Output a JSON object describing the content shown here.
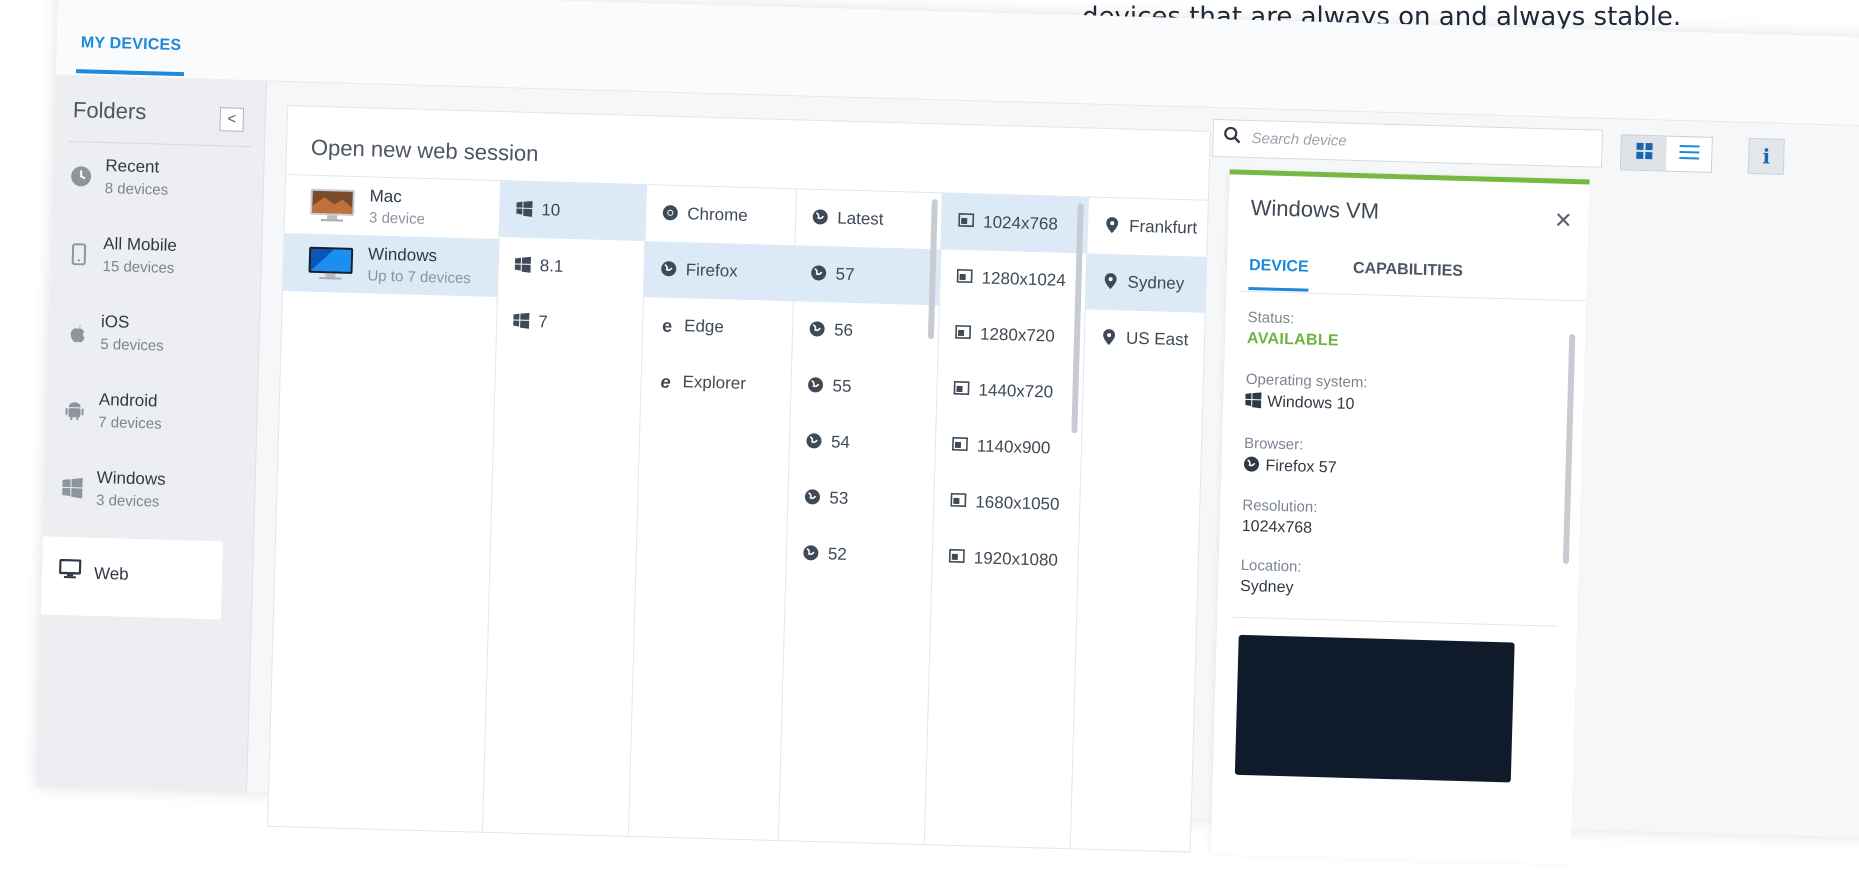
{
  "tagline": "devices that are always on and always stable.",
  "header": {
    "tab_label": "MY DEVICES"
  },
  "sidebar": {
    "title": "Folders",
    "collapse_icon": "chevron-left-icon",
    "items": [
      {
        "name": "Recent",
        "count": "8 devices",
        "icon": "clock-icon"
      },
      {
        "name": "All Mobile",
        "count": "15 devices",
        "icon": "phone-icon"
      },
      {
        "name": "iOS",
        "count": "5 devices",
        "icon": "apple-icon"
      },
      {
        "name": "Android",
        "count": "7 devices",
        "icon": "android-icon"
      },
      {
        "name": "Windows",
        "count": "3 devices",
        "icon": "windows-icon"
      },
      {
        "name": "Web",
        "icon": "monitor-icon"
      }
    ]
  },
  "search": {
    "placeholder": "Search device"
  },
  "main": {
    "title": "Open new web session",
    "os": [
      {
        "name": "Mac",
        "sub": "3 device"
      },
      {
        "name": "Windows",
        "sub": "Up to 7 devices"
      }
    ],
    "versions": [
      "10",
      "8.1",
      "7"
    ],
    "browsers": [
      "Chrome",
      "Firefox",
      "Edge",
      "Explorer"
    ],
    "browser_versions": [
      "Latest",
      "57",
      "56",
      "55",
      "54",
      "53",
      "52"
    ],
    "resolutions": [
      "1024x768",
      "1280x1024",
      "1280x720",
      "1440x720",
      "1140x900",
      "1680x1050",
      "1920x1080"
    ],
    "locations": [
      "Frankfurt",
      "Sydney",
      "US East"
    ]
  },
  "panel": {
    "title": "Windows VM",
    "tabs": [
      "DEVICE",
      "CAPABILITIES"
    ],
    "status_label": "Status:",
    "status_value": "AVAILABLE",
    "os_label": "Operating system:",
    "os_value": "Windows 10",
    "browser_label": "Browser:",
    "browser_value": "Firefox 57",
    "resolution_label": "Resolution:",
    "resolution_value": "1024x768",
    "location_label": "Location:",
    "location_value": "Sydney"
  },
  "colors": {
    "accent": "#1c8ad8",
    "available": "#6db33f",
    "selected_row": "#dceaf8",
    "panel_top": "#76b843"
  }
}
